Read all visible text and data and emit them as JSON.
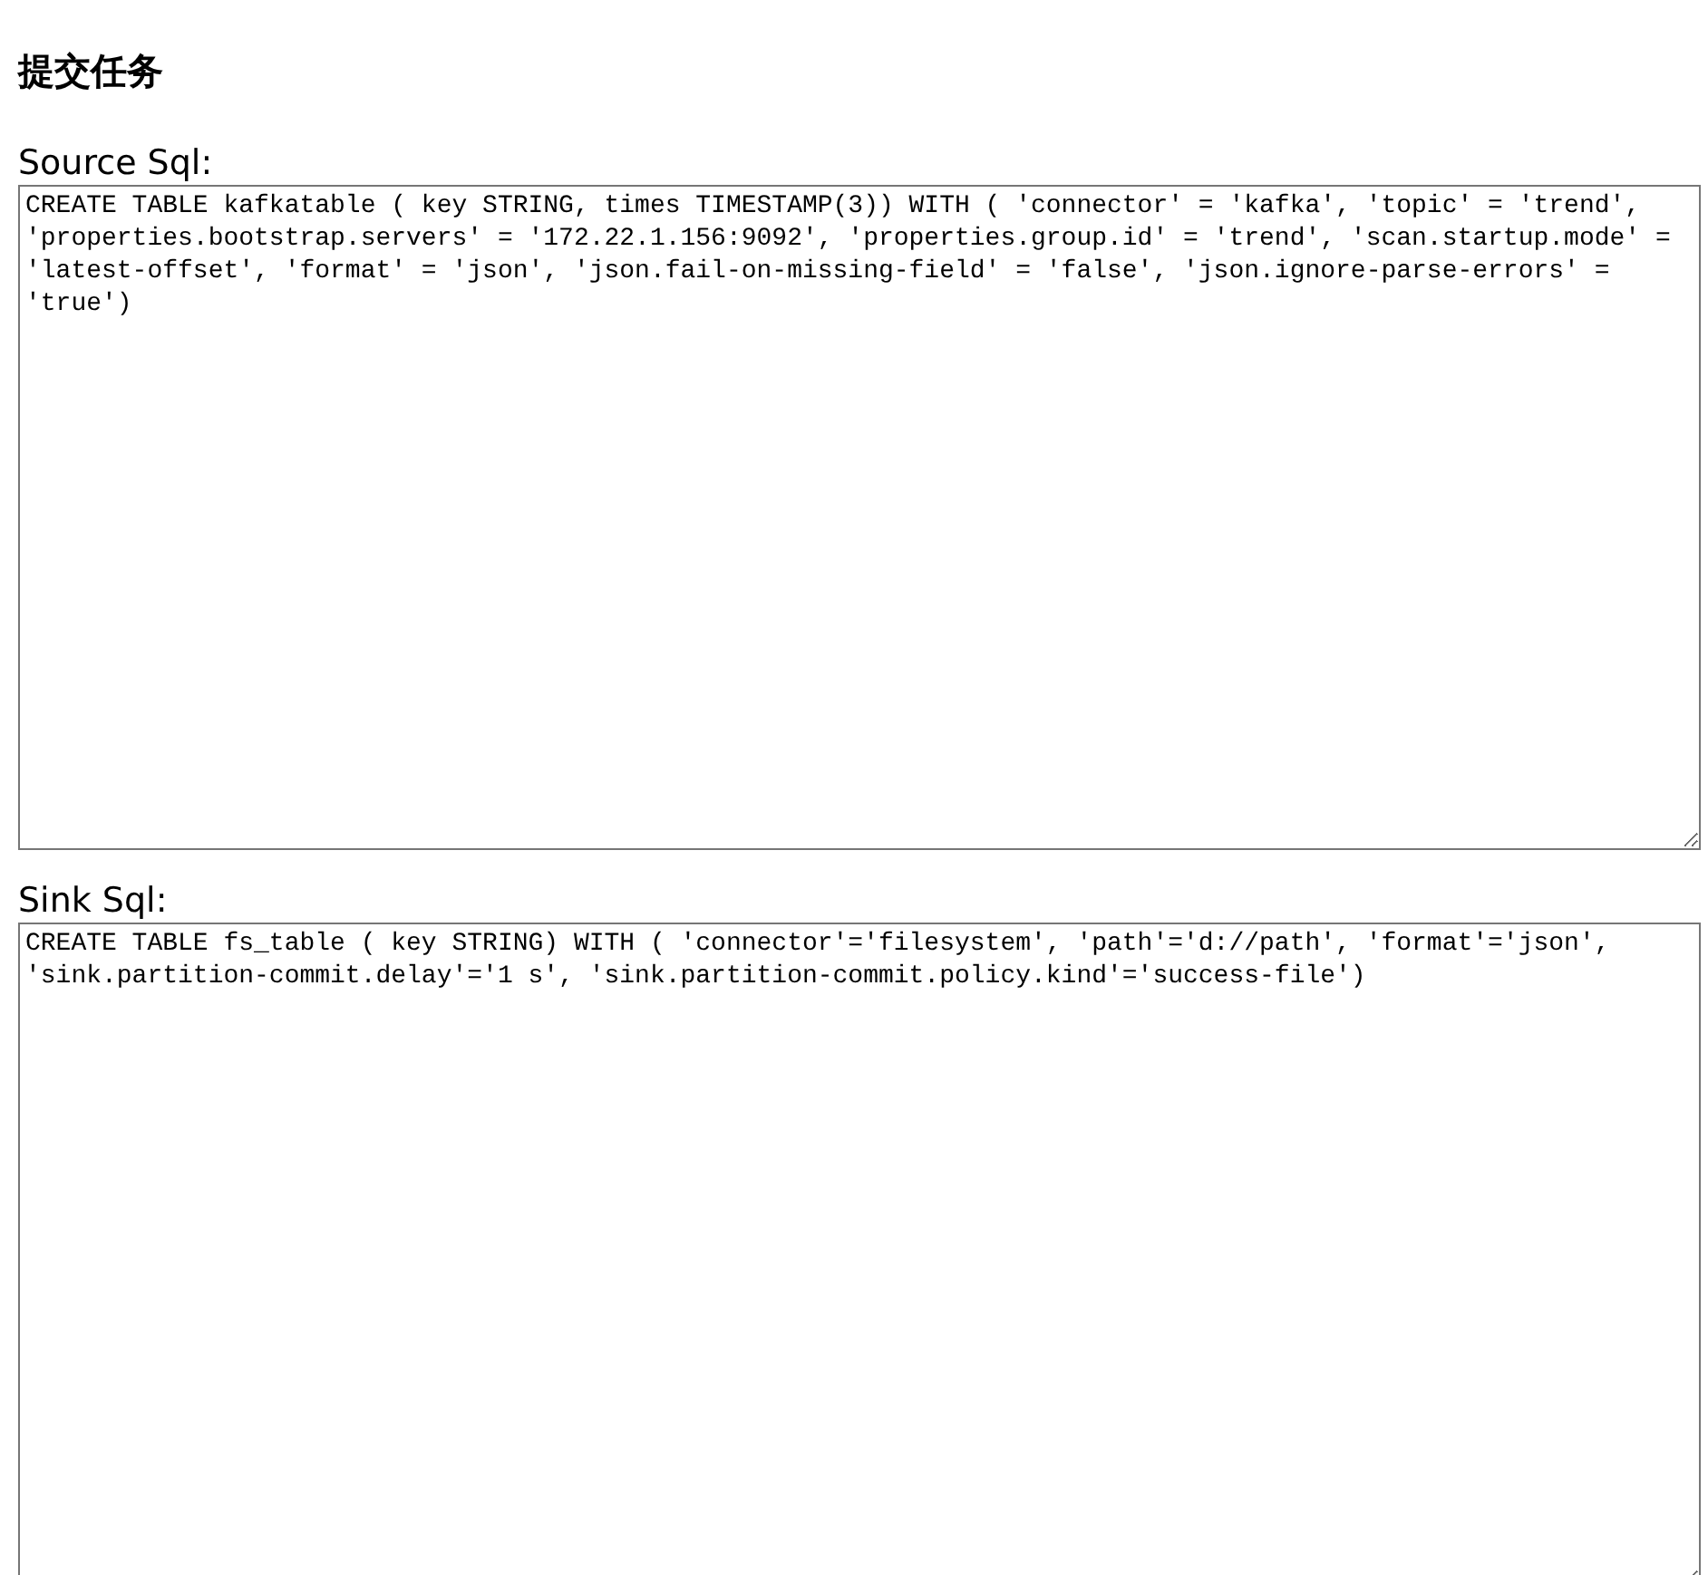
{
  "title": "提交任务",
  "fields": [
    {
      "label": "Source Sql:",
      "value": "CREATE TABLE kafkatable ( key STRING, times TIMESTAMP(3)) WITH ( 'connector' = 'kafka', 'topic' = 'trend', 'properties.bootstrap.servers' = '172.22.1.156:9092', 'properties.group.id' = 'trend', 'scan.startup.mode' = 'latest-offset', 'format' = 'json', 'json.fail-on-missing-field' = 'false', 'json.ignore-parse-errors' = 'true')"
    },
    {
      "label": "Sink Sql:",
      "value": "CREATE TABLE fs_table ( key STRING) WITH ( 'connector'='filesystem', 'path'='d://path', 'format'='json', 'sink.partition-commit.delay'='1 s', 'sink.partition-commit.policy.kind'='success-file')"
    }
  ]
}
